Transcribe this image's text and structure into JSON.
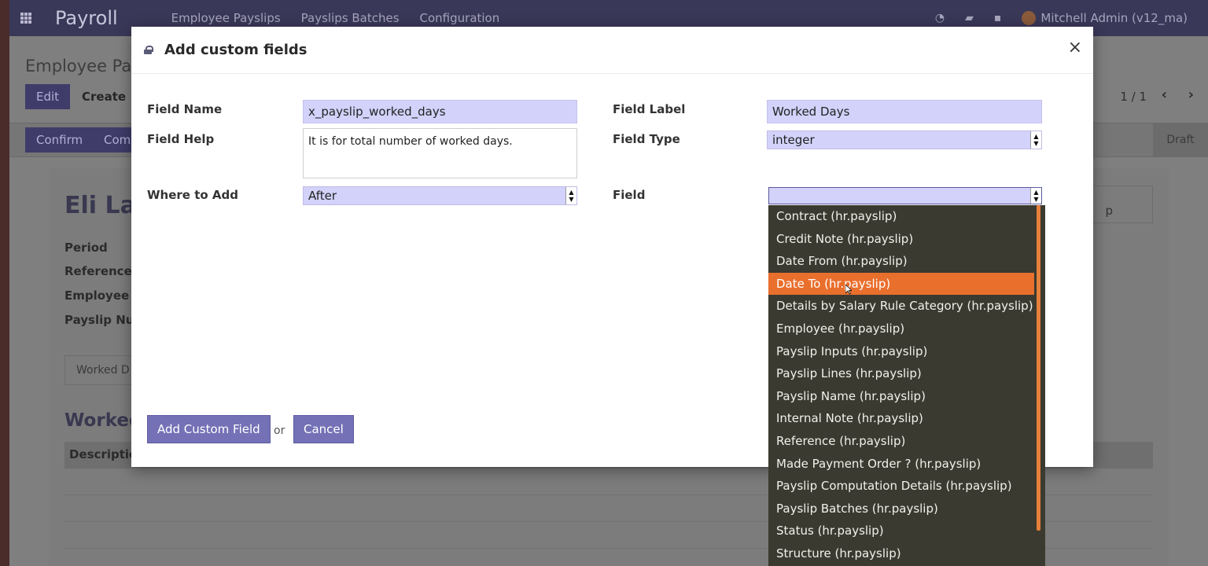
{
  "app": {
    "title": "Payroll",
    "menu": [
      "Employee Payslips",
      "Payslips Batches",
      "Configuration"
    ],
    "user": "Mitchell Admin (v12_ma)"
  },
  "background": {
    "breadcrumb": "Employee Pa",
    "edit_label": "Edit",
    "create_label": "Create",
    "pager": "1 / 1",
    "confirm_label": "Confirm",
    "confirm2_label": "Com",
    "status": "Draft",
    "employee_name": "Eli La",
    "labels": [
      "Period",
      "Reference",
      "Employee S",
      "Payslip Nu"
    ],
    "worked_tab": "Worked D",
    "worked_heading": "Worked",
    "desc_header": "Descriptio",
    "right_fragment": "p"
  },
  "modal": {
    "title": "Add custom fields",
    "close_symbol": "×",
    "field_name_label": "Field Name",
    "field_name_value": "x_payslip_worked_days",
    "field_label_label": "Field Label",
    "field_label_value": "Worked Days",
    "field_help_label": "Field Help",
    "field_help_value": "It is for total number of worked days.",
    "field_type_label": "Field Type",
    "field_type_value": "integer",
    "where_label": "Where to Add",
    "where_value": "After",
    "field_label": "Field",
    "add_button": "Add Custom Field",
    "or_text": "or",
    "cancel_button": "Cancel"
  },
  "dropdown": {
    "selected_index": 3,
    "items": [
      "Contract (hr.payslip)",
      "Credit Note (hr.payslip)",
      "Date From (hr.payslip)",
      "Date To (hr.payslip)",
      "Details by Salary Rule Category (hr.payslip)",
      "Employee (hr.payslip)",
      "Payslip Inputs (hr.payslip)",
      "Payslip Lines (hr.payslip)",
      "Payslip Name (hr.payslip)",
      "Internal Note (hr.payslip)",
      "Reference (hr.payslip)",
      "Made Payment Order ? (hr.payslip)",
      "Payslip Computation Details (hr.payslip)",
      "Payslip Batches (hr.payslip)",
      "Status (hr.payslip)",
      "Structure (hr.payslip)"
    ]
  },
  "colors": {
    "accent": "#7471b6",
    "selected_item": "#e96f2d",
    "input_bg": "#d2d2fa"
  }
}
